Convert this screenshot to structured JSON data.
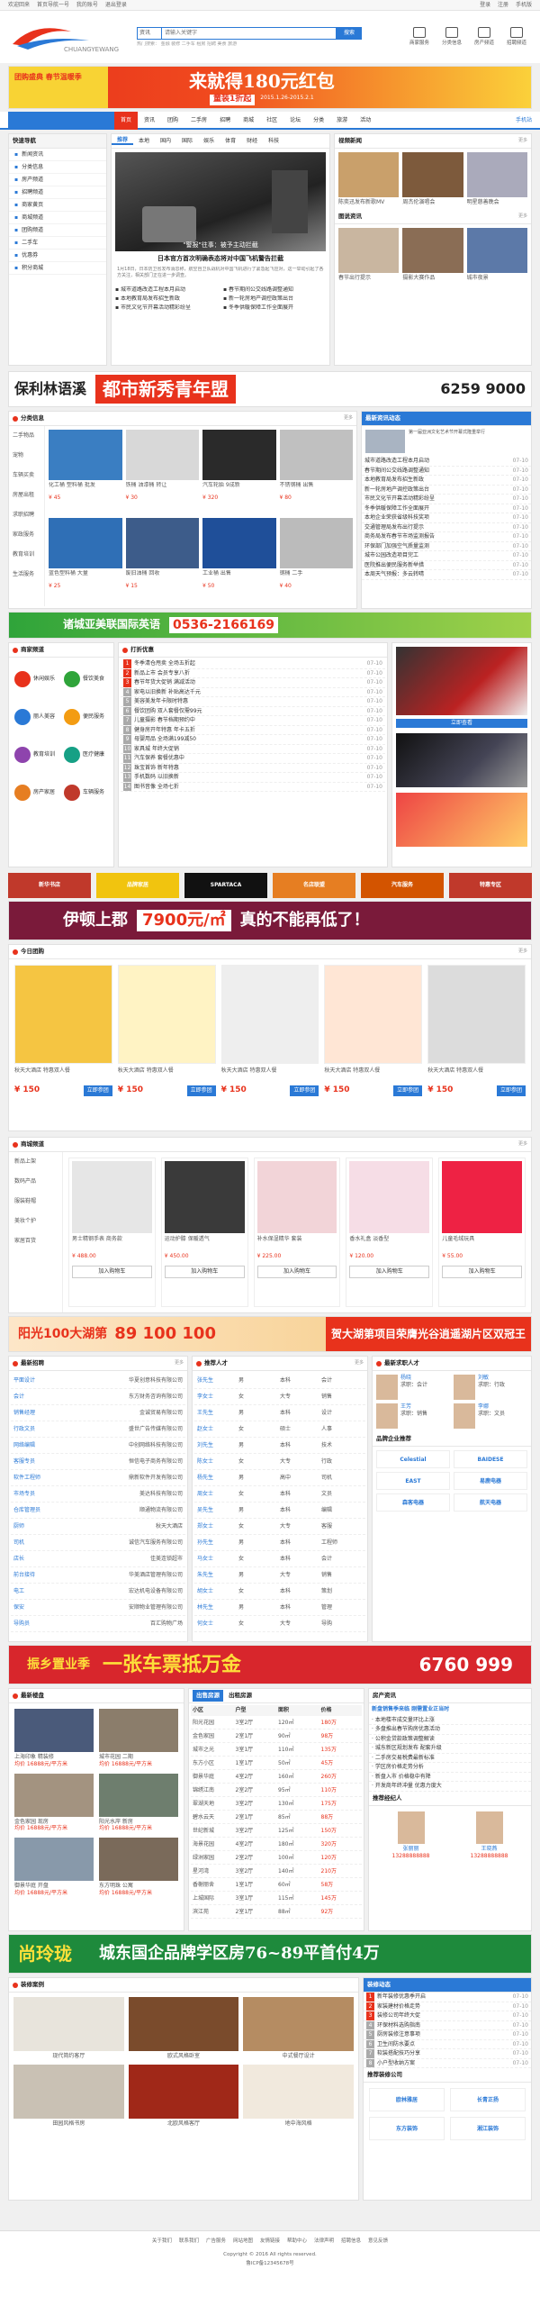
{
  "topbar": {
    "left": [
      "欢迎回来",
      "首页导航一号",
      "我的账号",
      "退出登录"
    ],
    "right": [
      "登录",
      "注册",
      "手机版"
    ]
  },
  "search": {
    "select": "资讯",
    "placeholder": "请输入关键字",
    "button": "搜索",
    "hot": "热门搜索： 金融 装修 二手车 租房 招聘 美食 旅游"
  },
  "headnav": [
    "商家服务",
    "分类信息",
    "房产频道",
    "招聘频道"
  ],
  "banner1": {
    "main": "来就得180元红包",
    "sub": "童装1折起",
    "left": "团购盛典 春节温暖季",
    "date": "2015.1.26-2015.2.1"
  },
  "nav": {
    "items": [
      "首页",
      "资讯",
      "团购",
      "二手房",
      "招聘",
      "商城",
      "社区",
      "论坛",
      "分类",
      "旅游",
      "活动"
    ],
    "right": "手机站"
  },
  "sidebar": {
    "title": "快速导航",
    "items": [
      "新闻资讯",
      "分类信息",
      "房产频道",
      "招聘频道",
      "商家黄页",
      "商城频道",
      "团购频道",
      "二手车",
      "优惠券",
      "积分商城"
    ]
  },
  "tabs": [
    "推荐",
    "本地",
    "国内",
    "国际",
    "娱乐",
    "体育",
    "财经",
    "科技"
  ],
  "headline": {
    "title": "日本官方首次明确表态将对中国飞机警告拦截",
    "caption": "\"警报\"往事：被予主动拦截"
  },
  "videos": {
    "title": "视频新闻",
    "items": [
      "陈奕迅发布新歌MV",
      "周杰伦演唱会",
      "明星慈善晚会"
    ]
  },
  "pics": {
    "title": "图说资讯",
    "items": [
      "春节出行提示",
      "摄影大赛作品",
      "城市夜景"
    ]
  },
  "banner2": {
    "brand": "保利林语溪",
    "main": "都市新秀青年盟",
    "phone": "6259 9000"
  },
  "classified": {
    "title": "分类信息",
    "more": "更多",
    "cats": [
      "二手物品",
      "宠物",
      "车辆买卖",
      "房屋出租",
      "求职招聘",
      "家政服务",
      "教育培训",
      "生活服务"
    ],
    "items": [
      {
        "n": "化工桶 塑料桶 批发",
        "p": "¥ 45"
      },
      {
        "n": "铁桶 油漆桶 转让",
        "p": "¥ 30"
      },
      {
        "n": "汽车轮胎 9成新",
        "p": "¥ 320"
      },
      {
        "n": "不锈钢桶 出售",
        "p": "¥ 80"
      },
      {
        "n": "蓝色塑料桶 大量",
        "p": "¥ 25"
      },
      {
        "n": "废旧油桶 回收",
        "p": "¥ 15"
      },
      {
        "n": "工业桶 出售",
        "p": "¥ 50"
      },
      {
        "n": "钢桶 二手",
        "p": "¥ 40"
      }
    ]
  },
  "latest": {
    "title": "最新资讯动态",
    "items": [
      "城市道路改造工程本月启动",
      "春节期间公交线路调整通知",
      "本地教育局发布招生新政",
      "新一轮房地产调控政策出台",
      "市民文化节开幕活动精彩纷呈",
      "冬季供暖保障工作全面展开",
      "本地企业荣获省级科技奖项",
      "交通管理局发布出行提示",
      "商务局发布春节市场监测报告",
      "环保部门加强空气质量监测",
      "城市公园改造项目完工",
      "医院推出便民服务新举措",
      "本周天气预报：多云转晴"
    ],
    "date": "07-10"
  },
  "banner3": {
    "main": "诸城亚美联国际英语",
    "phone": "0536-2166169"
  },
  "business": {
    "title": "商家频道",
    "cats": [
      "休闲娱乐",
      "餐饮美食",
      "丽人美容",
      "便民服务",
      "教育培训",
      "医疗健康",
      "房产家居",
      "车辆服务"
    ]
  },
  "promo": {
    "title": "打折优惠",
    "items": [
      "冬季清仓甩卖 全场五折起",
      "新品上市 会员专享八折",
      "春节年货大促销 满减活动",
      "家电以旧换新 补贴高达千元",
      "美容美发年卡限时特惠",
      "餐饮团购 双人套餐仅需99元",
      "儿童摄影 春节档期预约中",
      "健身房开年特惠 年卡五折",
      "母婴用品 全场满199减50",
      "家具城 年终大促销",
      "汽车保养 套餐优惠中",
      "珠宝首饰 新年特惠",
      "手机数码 以旧换新",
      "图书音像 全场七折"
    ],
    "date": "07-10"
  },
  "ads": [
    "新华书店",
    "品牌家居",
    "SPARTACA",
    "名店联盟",
    "汽车服务",
    "特惠专区"
  ],
  "banner4": {
    "brand": "伊顿上郡",
    "price": "7900元/㎡",
    "tail": "真的不能再低了！"
  },
  "tuan": {
    "title": "今日团购",
    "more": "更多",
    "items": [
      {
        "n": "秋天大酒店 特惠双人餐",
        "p": "¥ 150",
        "b": "立即参团"
      },
      {
        "n": "秋天大酒店 特惠双人餐",
        "p": "¥ 150",
        "b": "立即参团"
      },
      {
        "n": "秋天大酒店 特惠双人餐",
        "p": "¥ 150",
        "b": "立即参团"
      },
      {
        "n": "秋天大酒店 特惠双人餐",
        "p": "¥ 150",
        "b": "立即参团"
      },
      {
        "n": "秋天大酒店 特惠双人餐",
        "p": "¥ 150",
        "b": "立即参团"
      }
    ]
  },
  "shop": {
    "title": "商城频道",
    "more": "更多",
    "cats": [
      "新品上架",
      "数码产品",
      "服装鞋帽",
      "美妆个护",
      "家居百货"
    ],
    "items": [
      {
        "n": "男士精钢手表 商务款",
        "p": "¥ 488.00"
      },
      {
        "n": "运动护膝 保暖透气",
        "p": "¥ 450.00"
      },
      {
        "n": "补水保湿精华 套装",
        "p": "¥ 225.00"
      },
      {
        "n": "香水礼盒 淡香型",
        "p": "¥ 120.00"
      },
      {
        "n": "儿童毛绒玩具",
        "p": "¥ 55.00"
      }
    ],
    "buy": "加入购物车"
  },
  "banner5": {
    "main": "阳光100大湖第",
    "phone": "89 100 100",
    "tail": "贺大湖第项目荣膺光谷逍遥湖片区双冠王"
  },
  "jobs": {
    "title": "最新招聘",
    "more": "更多",
    "items": [
      {
        "t": "平面设计",
        "c": "华夏创意科技有限公司"
      },
      {
        "t": "会计",
        "c": "东方财务咨询有限公司"
      },
      {
        "t": "销售经理",
        "c": "金诚贸易有限公司"
      },
      {
        "t": "行政文员",
        "c": "盛世广告传媒有限公司"
      },
      {
        "t": "网络编辑",
        "c": "中创网络科技有限公司"
      },
      {
        "t": "客服专员",
        "c": "恒信电子商务有限公司"
      },
      {
        "t": "软件工程师",
        "c": "鼎新软件开发有限公司"
      },
      {
        "t": "市场专员",
        "c": "美达科技有限公司"
      },
      {
        "t": "仓库管理员",
        "c": "顺通物流有限公司"
      },
      {
        "t": "厨师",
        "c": "秋天大酒店"
      },
      {
        "t": "司机",
        "c": "诚信汽车服务有限公司"
      },
      {
        "t": "店长",
        "c": "佳美连锁超市"
      },
      {
        "t": "前台接待",
        "c": "华美酒店管理有限公司"
      },
      {
        "t": "电工",
        "c": "宏达机电设备有限公司"
      },
      {
        "t": "保安",
        "c": "安顺物业管理有限公司"
      },
      {
        "t": "导购员",
        "c": "百汇购物广场"
      }
    ]
  },
  "talent": {
    "title": "推荐人才",
    "more": "更多",
    "items": [
      {
        "n": "张先生",
        "g": "男",
        "e": "本科",
        "j": "会计"
      },
      {
        "n": "李女士",
        "g": "女",
        "e": "大专",
        "j": "销售"
      },
      {
        "n": "王先生",
        "g": "男",
        "e": "本科",
        "j": "设计"
      },
      {
        "n": "赵女士",
        "g": "女",
        "e": "硕士",
        "j": "人事"
      },
      {
        "n": "刘先生",
        "g": "男",
        "e": "本科",
        "j": "技术"
      },
      {
        "n": "陈女士",
        "g": "女",
        "e": "大专",
        "j": "行政"
      },
      {
        "n": "杨先生",
        "g": "男",
        "e": "高中",
        "j": "司机"
      },
      {
        "n": "周女士",
        "g": "女",
        "e": "本科",
        "j": "文员"
      },
      {
        "n": "吴先生",
        "g": "男",
        "e": "本科",
        "j": "编辑"
      },
      {
        "n": "郑女士",
        "g": "女",
        "e": "大专",
        "j": "客服"
      },
      {
        "n": "孙先生",
        "g": "男",
        "e": "本科",
        "j": "工程师"
      },
      {
        "n": "马女士",
        "g": "女",
        "e": "本科",
        "j": "会计"
      },
      {
        "n": "朱先生",
        "g": "男",
        "e": "大专",
        "j": "销售"
      },
      {
        "n": "胡女士",
        "g": "女",
        "e": "本科",
        "j": "策划"
      },
      {
        "n": "林先生",
        "g": "男",
        "e": "本科",
        "j": "管理"
      },
      {
        "n": "何女士",
        "g": "女",
        "e": "大专",
        "j": "导购"
      }
    ]
  },
  "seekers": {
    "title": "最新求职人才",
    "items": [
      {
        "n": "杨晓",
        "t": "求职：会计"
      },
      {
        "n": "刘敏",
        "t": "求职：行政"
      },
      {
        "n": "王芳",
        "t": "求职：销售"
      },
      {
        "n": "李娜",
        "t": "求职：文员"
      }
    ]
  },
  "brands": {
    "title": "品牌企业推荐",
    "items": [
      "Celestial",
      "BAIDESE",
      "EAST",
      "易鹿电器",
      "森客电器",
      "航天电器"
    ]
  },
  "banner6": {
    "main": "振乡置业季",
    "mid": "一张车票抵万金",
    "phone": "6760 999"
  },
  "loupan": {
    "title": "最新楼盘",
    "items": [
      {
        "n": "上海印象 精装修",
        "p": "均价 16888元/平方米"
      },
      {
        "n": "城市花园 二期",
        "p": "均价 16888元/平方米"
      },
      {
        "n": "金色家园 现房",
        "p": "均价 16888元/平方米"
      },
      {
        "n": "阳光水岸 新房",
        "p": "均价 16888元/平方米"
      },
      {
        "n": "御景华庭 开盘",
        "p": "均价 16888元/平方米"
      },
      {
        "n": "东方明珠 公寓",
        "p": "均价 16888元/平方米"
      }
    ]
  },
  "rent": {
    "tab1": "出售房源",
    "tab2": "出租房源",
    "head": [
      "小区",
      "户型",
      "面积",
      "价格"
    ],
    "rows": [
      {
        "a": "阳光花园",
        "b": "3室2厅",
        "c": "120㎡",
        "d": "180万"
      },
      {
        "a": "金色家园",
        "b": "2室1厅",
        "c": "90㎡",
        "d": "98万"
      },
      {
        "a": "城市之光",
        "b": "3室1厅",
        "c": "110㎡",
        "d": "135万"
      },
      {
        "a": "东方小区",
        "b": "1室1厅",
        "c": "50㎡",
        "d": "45万"
      },
      {
        "a": "御景华庭",
        "b": "4室2厅",
        "c": "160㎡",
        "d": "260万"
      },
      {
        "a": "锦绣江南",
        "b": "2室2厅",
        "c": "95㎡",
        "d": "110万"
      },
      {
        "a": "翠湖天地",
        "b": "3室2厅",
        "c": "130㎡",
        "d": "175万"
      },
      {
        "a": "碧水云天",
        "b": "2室1厅",
        "c": "85㎡",
        "d": "88万"
      },
      {
        "a": "世纪新城",
        "b": "3室2厅",
        "c": "125㎡",
        "d": "150万"
      },
      {
        "a": "海景花园",
        "b": "4室2厅",
        "c": "180㎡",
        "d": "320万"
      },
      {
        "a": "绿洲家园",
        "b": "2室2厅",
        "c": "100㎡",
        "d": "120万"
      },
      {
        "a": "星河湾",
        "b": "3室2厅",
        "c": "140㎡",
        "d": "210万"
      },
      {
        "a": "香榭丽舍",
        "b": "1室1厅",
        "c": "60㎡",
        "d": "58万"
      },
      {
        "a": "上城国际",
        "b": "3室1厅",
        "c": "115㎡",
        "d": "145万"
      },
      {
        "a": "滨江苑",
        "b": "2室1厅",
        "c": "88㎡",
        "d": "92万"
      }
    ]
  },
  "housenews": {
    "title": "房产资讯",
    "lead": "新盘销售季来临 刚需置业正当时",
    "items": [
      "本地楼市成交量环比上涨",
      "多盘推出春节购房优惠活动",
      "公积金贷款政策调整解读",
      "城东新区规划发布 配套升级",
      "二手房交易税费最新标准",
      "学区房价格走势分析",
      "新盘入市 价格稳中有降",
      "开发商年终冲量 优惠力度大"
    ]
  },
  "agents": {
    "title": "推荐经纪人",
    "items": [
      {
        "n": "张丽丽",
        "p": "13288888888"
      },
      {
        "n": "王晓燕",
        "p": "13288888888"
      }
    ]
  },
  "banner7": {
    "main": "尚玲珑",
    "tail": "城东国企品牌学区房76~89平首付4万"
  },
  "deco": {
    "title": "装修案例",
    "items": [
      "现代简约客厅",
      "欧式风格卧室",
      "中式餐厅设计",
      "田园风格书房",
      "北欧风格客厅",
      "地中海风格"
    ]
  },
  "decodeals": {
    "title": "装修动态",
    "items": [
      "新年装修优惠季开启",
      "家装建材价格走势",
      "装修公司年终大促",
      "环保材料选购指南",
      "厨房装修注意事项",
      "卫生间防水要点",
      "软装搭配技巧分享",
      "小户型收纳方案"
    ],
    "date": "07-10"
  },
  "decocom": {
    "title": "推荐装修公司",
    "items": [
      "欧林雅居",
      "长青正扬",
      "东方装饰",
      "湘江装饰"
    ]
  },
  "footer": {
    "links": [
      "关于我们",
      "联系我们",
      "广告服务",
      "网站地图",
      "友情链接",
      "帮助中心",
      "法律声明",
      "招聘信息",
      "意见反馈"
    ],
    "copy": "Copyright © 2016 All rights reserved.",
    "icp": "鲁ICP备12345678号"
  }
}
